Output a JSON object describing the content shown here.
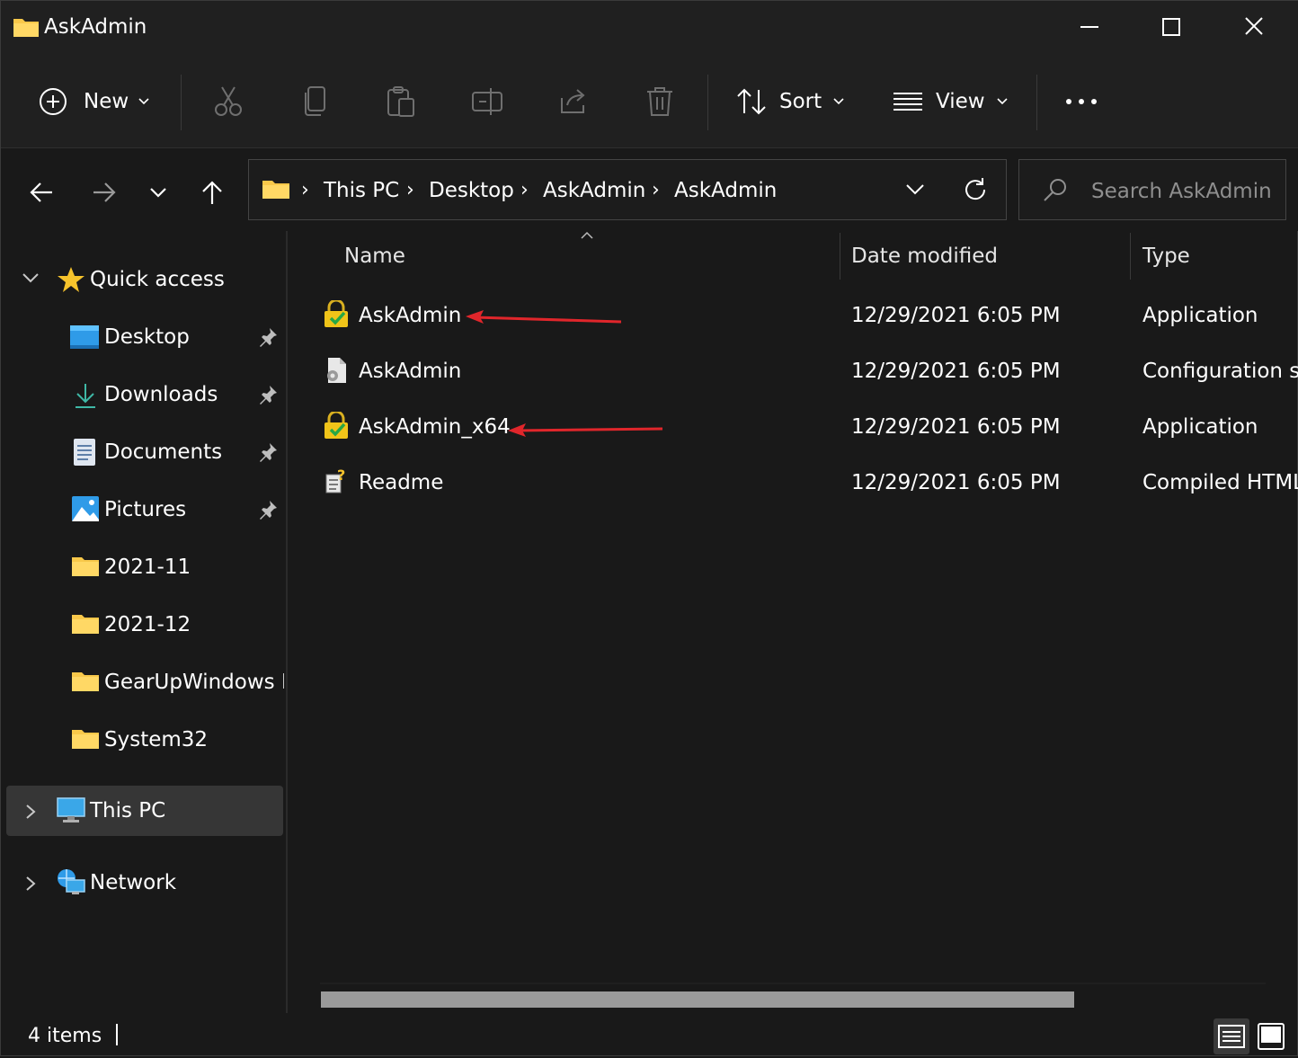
{
  "window": {
    "title": "AskAdmin",
    "minimize_icon": "minimize-icon",
    "maximize_icon": "maximize-icon",
    "close_icon": "close-icon"
  },
  "toolbar": {
    "new_label": "New",
    "sort_label": "Sort",
    "view_label": "View",
    "more_icon": "more-icon"
  },
  "address": {
    "crumbs": [
      "This PC",
      "Desktop",
      "AskAdmin",
      "AskAdmin"
    ]
  },
  "search": {
    "placeholder": "Search AskAdmin"
  },
  "sidebar": {
    "quick_access": "Quick access",
    "items": [
      {
        "label": "Desktop",
        "pinned": true
      },
      {
        "label": "Downloads",
        "pinned": true
      },
      {
        "label": "Documents",
        "pinned": true
      },
      {
        "label": "Pictures",
        "pinned": true
      },
      {
        "label": "2021-11",
        "pinned": false
      },
      {
        "label": "2021-12",
        "pinned": false
      },
      {
        "label": "GearUpWindows D",
        "pinned": false
      },
      {
        "label": "System32",
        "pinned": false
      }
    ],
    "this_pc": "This PC",
    "network": "Network"
  },
  "columns": {
    "name": "Name",
    "date": "Date modified",
    "type": "Type"
  },
  "files": [
    {
      "name": "AskAdmin",
      "date": "12/29/2021 6:05 PM",
      "type": "Application",
      "icon": "application-icon"
    },
    {
      "name": "AskAdmin",
      "date": "12/29/2021 6:05 PM",
      "type": "Configuration se",
      "icon": "config-icon"
    },
    {
      "name": "AskAdmin_x64",
      "date": "12/29/2021 6:05 PM",
      "type": "Application",
      "icon": "application-icon"
    },
    {
      "name": "Readme",
      "date": "12/29/2021 6:05 PM",
      "type": "Compiled HTML",
      "icon": "help-file-icon"
    }
  ],
  "status": {
    "count": "4 items"
  },
  "colors": {
    "background": "#191919",
    "toolbar": "#202020",
    "folder": "#f8c84a",
    "annotation_arrow": "#e0262b"
  }
}
